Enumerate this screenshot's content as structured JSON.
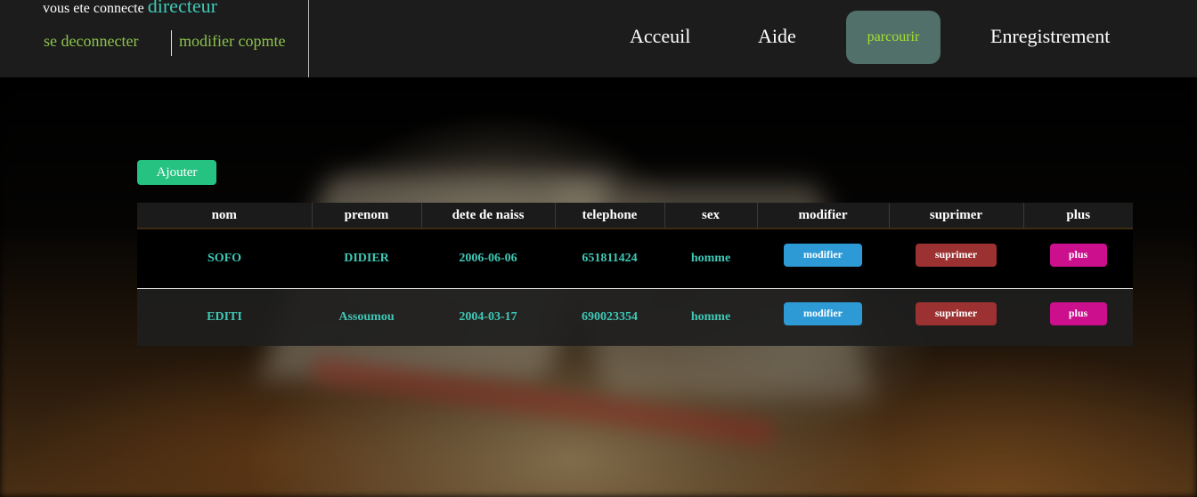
{
  "session": {
    "welcome_text": "vous ete connecte",
    "role": "directeur",
    "logout_label": "se deconnecter",
    "edit_account_label": "modifier copmte"
  },
  "nav": {
    "items": [
      {
        "label": "Acceuil",
        "active": false
      },
      {
        "label": "Aide",
        "active": false
      },
      {
        "label": "parcourir",
        "active": true
      },
      {
        "label": "Enregistrement",
        "active": false
      }
    ]
  },
  "add_button_label": "Ajouter",
  "table": {
    "headers": [
      "nom",
      "prenom",
      "dete de naiss",
      "telephone",
      "sex",
      "modifier",
      "suprimer",
      "plus"
    ],
    "rows": [
      {
        "nom": "SOFO",
        "prenom": "DIDIER",
        "naissance": "2006-06-06",
        "telephone": "651811424",
        "sex": "homme"
      },
      {
        "nom": "EDITI",
        "prenom": "Assoumou",
        "naissance": "2004-03-17",
        "telephone": "690023354",
        "sex": "homme"
      }
    ],
    "action_labels": {
      "modifier": "modifier",
      "suprimer": "suprimer",
      "plus": "plus"
    }
  },
  "colors": {
    "header_bg": "#1c1c1c",
    "accent_teal": "#3fc8b6",
    "link_green": "#8bc34a",
    "active_nav_bg": "#507069",
    "active_nav_text": "#a6e22e",
    "add_button": "#26c281",
    "modify_button": "#2d9ad6",
    "delete_button": "#9c3131",
    "more_button": "#cc0f8c"
  }
}
